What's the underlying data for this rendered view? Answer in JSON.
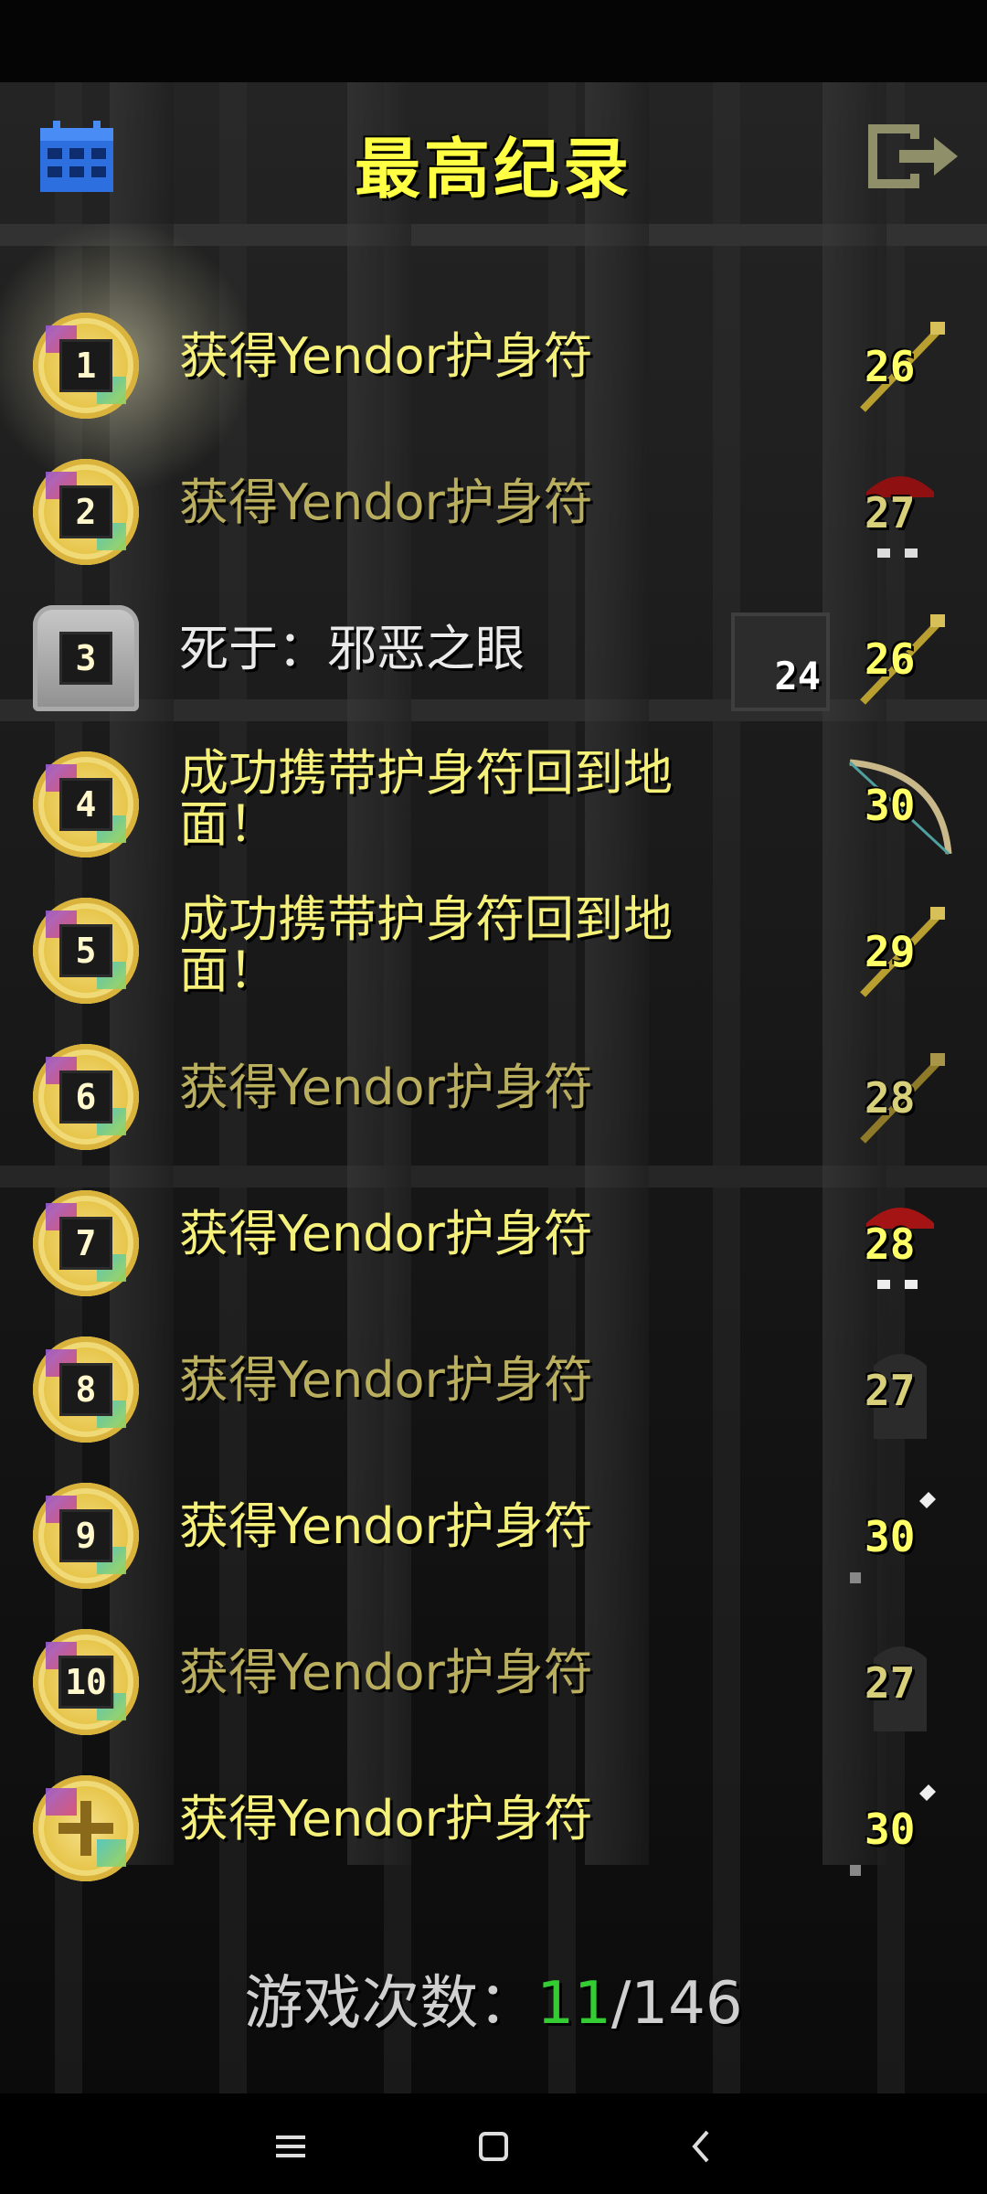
{
  "header": {
    "title": "最高纪录",
    "left_icon": "calendar-icon",
    "right_icon": "exit-icon"
  },
  "records": [
    {
      "rank": "1",
      "text": "获得Yendor护身符",
      "level": "26",
      "class_icon": "staff-icon",
      "style": "bright",
      "badge": "medal"
    },
    {
      "rank": "2",
      "text": "获得Yendor护身符",
      "level": "27",
      "class_icon": "helmet-icon",
      "style": "dim",
      "badge": "medal"
    },
    {
      "rank": "3",
      "text": "死于：邪恶之眼",
      "depth": "24",
      "level": "26",
      "class_icon": "staff-icon",
      "style": "white",
      "badge": "tombstone"
    },
    {
      "rank": "4",
      "text": "成功携带护身符回到地面！",
      "level": "30",
      "class_icon": "bow-icon",
      "style": "bright",
      "badge": "medal"
    },
    {
      "rank": "5",
      "text": "成功携带护身符回到地面！",
      "level": "29",
      "class_icon": "staff-icon",
      "style": "bright",
      "badge": "medal"
    },
    {
      "rank": "6",
      "text": "获得Yendor护身符",
      "level": "28",
      "class_icon": "staff-icon",
      "style": "dim",
      "badge": "medal"
    },
    {
      "rank": "7",
      "text": "获得Yendor护身符",
      "level": "28",
      "class_icon": "helmet-icon",
      "style": "bright",
      "badge": "medal"
    },
    {
      "rank": "8",
      "text": "获得Yendor护身符",
      "level": "27",
      "class_icon": "hood-icon",
      "style": "dim",
      "badge": "medal"
    },
    {
      "rank": "9",
      "text": "获得Yendor护身符",
      "level": "30",
      "class_icon": "dagger-icon",
      "style": "bright",
      "badge": "medal"
    },
    {
      "rank": "10",
      "text": "获得Yendor护身符",
      "level": "27",
      "class_icon": "hood-icon",
      "style": "dim",
      "badge": "medal"
    },
    {
      "rank": "",
      "text": "获得Yendor护身符",
      "level": "30",
      "class_icon": "dagger-icon",
      "style": "bright",
      "badge": "medal-cross"
    }
  ],
  "footer": {
    "label": "游戏次数：",
    "current": "11",
    "total": "/146"
  },
  "navbar": {
    "menu_icon": "menu-icon",
    "home_icon": "home-icon",
    "back_icon": "back-icon"
  },
  "colors": {
    "title": "#ffff44",
    "bright_text": "#f4f07a",
    "dim_text": "#b9ae5e",
    "games_current": "#33cc33"
  }
}
